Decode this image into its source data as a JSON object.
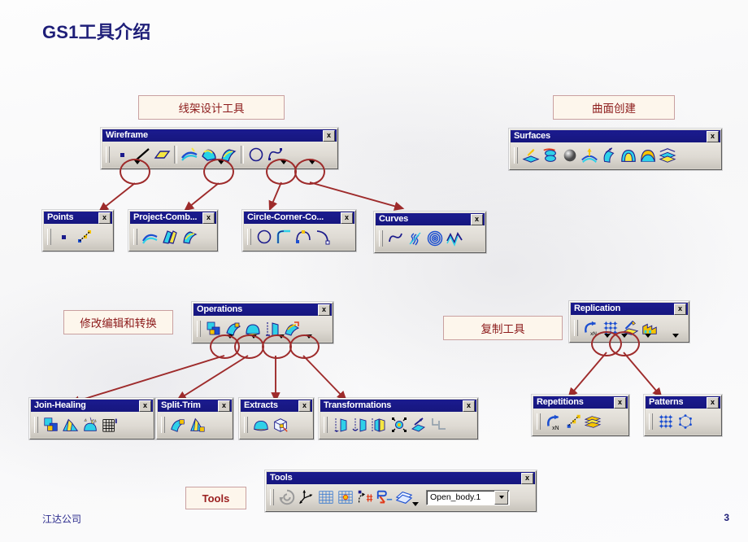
{
  "slide": {
    "title": "GS1工具介绍",
    "footer_text": "江达公司",
    "page_number": "3"
  },
  "labels": {
    "wireframe": "线架设计工具",
    "surfaces": "曲面创建",
    "operations": "修改编辑和转换",
    "replication": "复制工具",
    "tools": "Tools"
  },
  "toolbars": {
    "wireframe": {
      "title": "Wireframe",
      "close": "x",
      "icons": [
        "point-icon",
        "line-icon",
        "plane-icon",
        "projection-icon",
        "combine-curve-icon",
        "intersection-icon",
        "circle-icon",
        "spline-icon"
      ],
      "carets": 4
    },
    "points": {
      "title": "Points",
      "close": "x",
      "icons": [
        "point-icon",
        "points-repetition-icon"
      ]
    },
    "project_comb": {
      "title": "Project-Comb...",
      "close": "x",
      "icons": [
        "projection-icon",
        "combine-icon",
        "reflect-line-icon"
      ]
    },
    "circle_corner": {
      "title": "Circle-Corner-Co...",
      "close": "x",
      "icons": [
        "circle-icon",
        "corner-icon",
        "connect-curve-icon",
        "arc-icon"
      ]
    },
    "curves": {
      "title": "Curves",
      "close": "x",
      "icons": [
        "spline-icon",
        "helix-icon",
        "spiral-icon",
        "polyline-icon"
      ]
    },
    "surfaces": {
      "title": "Surfaces",
      "close": "x",
      "icons": [
        "extrude-icon",
        "revolve-icon",
        "sphere-icon",
        "offset-icon",
        "sweep-icon",
        "fill-icon",
        "blend-icon",
        "multi-section-icon"
      ]
    },
    "operations": {
      "title": "Operations",
      "close": "x",
      "icons": [
        "join-icon",
        "split-icon",
        "extract-icon",
        "transform-icon",
        "extrapolate-icon"
      ],
      "carets": 4
    },
    "join_healing": {
      "title": "Join-Healing",
      "close": "x",
      "icons": [
        "join-icon",
        "healing-icon",
        "untrim-icon",
        "disassemble-icon"
      ]
    },
    "split_trim": {
      "title": "Split-Trim",
      "close": "x",
      "icons": [
        "split-icon",
        "trim-icon"
      ]
    },
    "extracts": {
      "title": "Extracts",
      "close": "x",
      "icons": [
        "boundary-icon",
        "extract-icon"
      ]
    },
    "transformations": {
      "title": "Transformations",
      "close": "x",
      "icons": [
        "translate-icon",
        "rotate-icon",
        "symmetry-icon",
        "scaling-icon",
        "affinity-icon",
        "axis-to-axis-icon"
      ]
    },
    "replication": {
      "title": "Replication",
      "close": "x",
      "icons": [
        "object-repetition-icon",
        "pattern-icon",
        "powercopy-icon",
        "user-feature-icon"
      ],
      "carets": 4
    },
    "repetitions": {
      "title": "Repetitions",
      "close": "x",
      "icons": [
        "object-repetition-icon",
        "points-repetition-icon",
        "planes-repetition-icon"
      ]
    },
    "patterns": {
      "title": "Patterns",
      "close": "x",
      "icons": [
        "rectangular-pattern-icon",
        "circular-pattern-icon"
      ]
    },
    "tools": {
      "title": "Tools",
      "close": "x",
      "icons": [
        "update-icon",
        "axis-system-icon",
        "work-on-support-icon",
        "snap-to-point-icon",
        "create-datum-icon",
        "stacking-icon",
        "open-body-icon"
      ],
      "combo_value": "Open_body.1"
    }
  },
  "colors": {
    "title_text": "#1e1e78",
    "label_border": "#c9a0a0",
    "label_bg": "#fdf6ec",
    "label_text": "#8c1a1a",
    "arrow": "#9e2b2b",
    "ring": "#9e2b2b",
    "titlebar": "#16167e"
  }
}
